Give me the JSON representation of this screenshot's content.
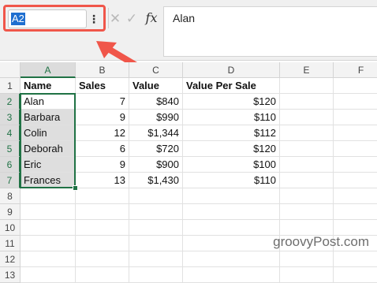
{
  "formula_bar": {
    "name_box": "A2",
    "menu_icon": "more-vertical-icon",
    "cancel_icon": "close-icon",
    "enter_icon": "check-icon",
    "function_icon": "fx",
    "value": "Alan"
  },
  "annotation": {
    "box_color": "#f0564a",
    "arrow_color": "#f0564a"
  },
  "sheet": {
    "columns": [
      "A",
      "B",
      "C",
      "D",
      "E",
      "F"
    ],
    "rows": [
      "1",
      "2",
      "3",
      "4",
      "5",
      "6",
      "7",
      "8",
      "9",
      "10",
      "11",
      "12",
      "13"
    ],
    "active_cell": "A2",
    "selection": "A2:A7",
    "cells": [
      [
        "Name",
        "Sales",
        "Value",
        "Value Per Sale",
        "",
        ""
      ],
      [
        "Alan",
        "7",
        "$840",
        "$120",
        "",
        ""
      ],
      [
        "Barbara",
        "9",
        "$990",
        "$110",
        "",
        ""
      ],
      [
        "Colin",
        "12",
        "$1,344",
        "$112",
        "",
        ""
      ],
      [
        "Deborah",
        "6",
        "$720",
        "$120",
        "",
        ""
      ],
      [
        "Eric",
        "9",
        "$900",
        "$100",
        "",
        ""
      ],
      [
        "Frances",
        "13",
        "$1,430",
        "$110",
        "",
        ""
      ]
    ]
  },
  "watermark": "groovyPost.com",
  "colors": {
    "selection_accent": "#207245",
    "name_box_highlight": "#1f6fd0"
  }
}
